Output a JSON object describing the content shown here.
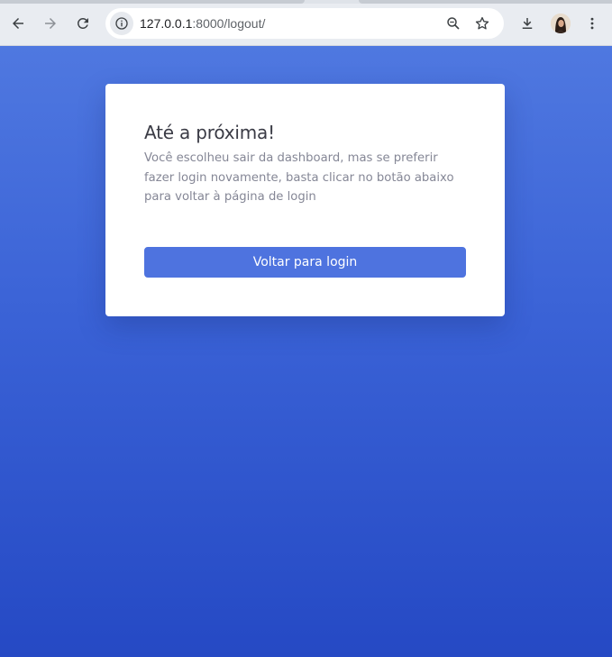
{
  "browser": {
    "url_host": "127.0.0.1",
    "url_rest": ":8000/logout/",
    "icons": {
      "back": "arrow-left-icon",
      "forward": "arrow-right-icon",
      "reload": "reload-icon",
      "site_info": "info-icon",
      "zoom": "zoom-icon",
      "bookmark": "star-icon",
      "download": "download-icon",
      "profile": "avatar",
      "menu": "kebab-menu-icon"
    }
  },
  "page": {
    "background_top": "#4f78e0",
    "background_bottom": "#2549c4",
    "card": {
      "title": "Até a próxima!",
      "message": "Você escolheu sair da dashboard, mas se preferir fazer login novamente, basta clicar no botão abaixo para voltar à página de login",
      "button_label": "Voltar para login",
      "button_color": "#4e73df"
    }
  }
}
